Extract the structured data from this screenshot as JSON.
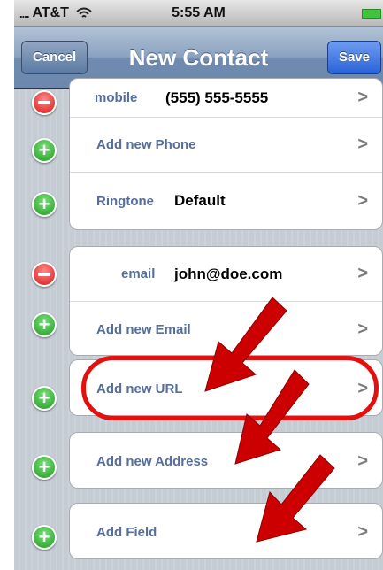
{
  "status_bar": {
    "signal": "....",
    "carrier": "AT&T",
    "time": "5:55 AM",
    "wifi_icon": "wifi-icon",
    "battery_icon": "battery-icon"
  },
  "nav": {
    "title": "New Contact",
    "cancel_label": "Cancel",
    "save_label": "Save"
  },
  "rows": {
    "mobile_label": "mobile",
    "mobile_value": "(555) 555-5555",
    "add_phone": "Add new Phone",
    "ringtone_label": "Ringtone",
    "ringtone_value": "Default",
    "email_label": "email",
    "email_value": "john@doe.com",
    "add_email": "Add new Email",
    "add_url": "Add new URL",
    "add_address": "Add new Address",
    "add_field": "Add Field",
    "chevron": ">"
  },
  "colors": {
    "annotation_red": "#cc0000",
    "highlight_ring": "#e40f0f",
    "label_blue": "#556e9c"
  }
}
